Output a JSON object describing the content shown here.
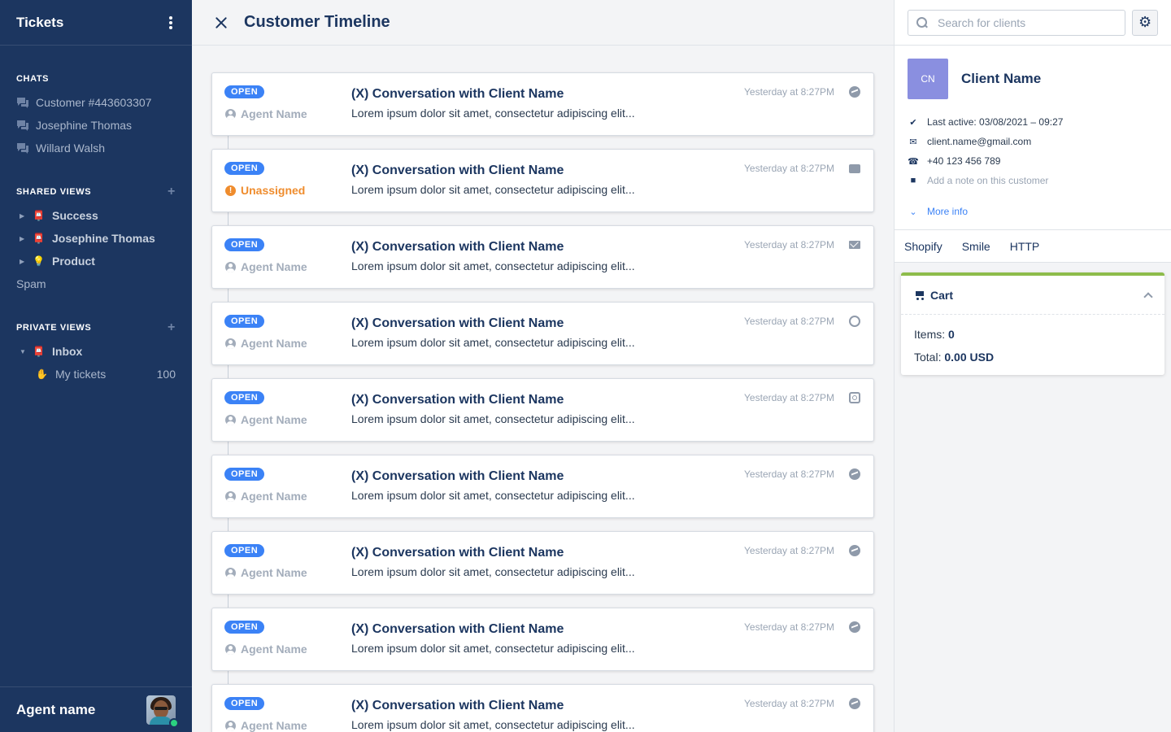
{
  "sidebar": {
    "title": "Tickets",
    "chats_title": "CHATS",
    "chats": [
      {
        "label": "Customer #443603307"
      },
      {
        "label": "Josephine Thomas"
      },
      {
        "label": "Willard Walsh"
      }
    ],
    "shared_views_title": "SHARED VIEWS",
    "shared_views": [
      {
        "label": "Success",
        "emoji": "📮"
      },
      {
        "label": "Josephine Thomas",
        "emoji": "📮"
      },
      {
        "label": "Product",
        "emoji": "💡"
      }
    ],
    "spam_label": "Spam",
    "private_views_title": "PRIVATE VIEWS",
    "private_views": [
      {
        "label": "Inbox",
        "emoji": "📮"
      },
      {
        "label": "My tickets",
        "emoji": "✋",
        "count": "100"
      }
    ],
    "agent_name": "Agent name"
  },
  "main": {
    "title": "Customer Timeline",
    "tickets": [
      {
        "status": "OPEN",
        "assignee": "Agent Name",
        "title": "(X) Conversation with Client Name",
        "snippet": "Lorem ipsum dolor sit amet, consectetur adipiscing elit...",
        "time": "Yesterday at 8:27PM",
        "channel": "messenger-icon"
      },
      {
        "status": "OPEN",
        "assignee": "Unassigned",
        "title": "(X) Conversation with Client Name",
        "snippet": "Lorem ipsum dolor sit amet, consectetur adipiscing elit...",
        "time": "Yesterday at 8:27PM",
        "channel": "chat-icon"
      },
      {
        "status": "OPEN",
        "assignee": "Agent Name",
        "title": "(X) Conversation with Client Name",
        "snippet": "Lorem ipsum dolor sit amet, consectetur adipiscing elit...",
        "time": "Yesterday at 8:27PM",
        "channel": "mail-icon"
      },
      {
        "status": "OPEN",
        "assignee": "Agent Name",
        "title": "(X) Conversation with Client Name",
        "snippet": "Lorem ipsum dolor sit amet, consectetur adipiscing elit...",
        "time": "Yesterday at 8:27PM",
        "channel": "at-sign-icon"
      },
      {
        "status": "OPEN",
        "assignee": "Agent Name",
        "title": "(X) Conversation with Client Name",
        "snippet": "Lorem ipsum dolor sit amet, consectetur adipiscing elit...",
        "time": "Yesterday at 8:27PM",
        "channel": "instagram-icon"
      },
      {
        "status": "OPEN",
        "assignee": "Agent Name",
        "title": "(X) Conversation with Client Name",
        "snippet": "Lorem ipsum dolor sit amet, consectetur adipiscing elit...",
        "time": "Yesterday at 8:27PM",
        "channel": "messenger-icon"
      },
      {
        "status": "OPEN",
        "assignee": "Agent Name",
        "title": "(X) Conversation with Client Name",
        "snippet": "Lorem ipsum dolor sit amet, consectetur adipiscing elit...",
        "time": "Yesterday at 8:27PM",
        "channel": "messenger-icon"
      },
      {
        "status": "OPEN",
        "assignee": "Agent Name",
        "title": "(X) Conversation with Client Name",
        "snippet": "Lorem ipsum dolor sit amet, consectetur adipiscing elit...",
        "time": "Yesterday at 8:27PM",
        "channel": "messenger-icon"
      },
      {
        "status": "OPEN",
        "assignee": "Agent Name",
        "title": "(X) Conversation with Client Name",
        "snippet": "Lorem ipsum dolor sit amet, consectetur adipiscing elit...",
        "time": "Yesterday at 8:27PM",
        "channel": "messenger-icon"
      }
    ]
  },
  "right": {
    "search_placeholder": "Search for clients",
    "client": {
      "initials": "CN",
      "name": "Client Name",
      "last_active": "Last active: 03/08/2021 – 09:27",
      "email": "client.name@gmail.com",
      "phone": "+40 123 456 789",
      "note_placeholder": "Add a note on this customer",
      "more_info": "More info"
    },
    "tabs": [
      "Shopify",
      "Smile",
      "HTTP"
    ],
    "cart": {
      "title": "Cart",
      "items_label": "Items:",
      "items_value": "0",
      "total_label": "Total:",
      "total_value": "0.00 USD"
    }
  },
  "colors": {
    "sidebar_bg": "#1c3660",
    "badge_blue": "#3b82f6",
    "unassigned_orange": "#ef8c2d",
    "cart_accent": "#8dbc4a",
    "client_avatar": "#8a8fe0"
  }
}
